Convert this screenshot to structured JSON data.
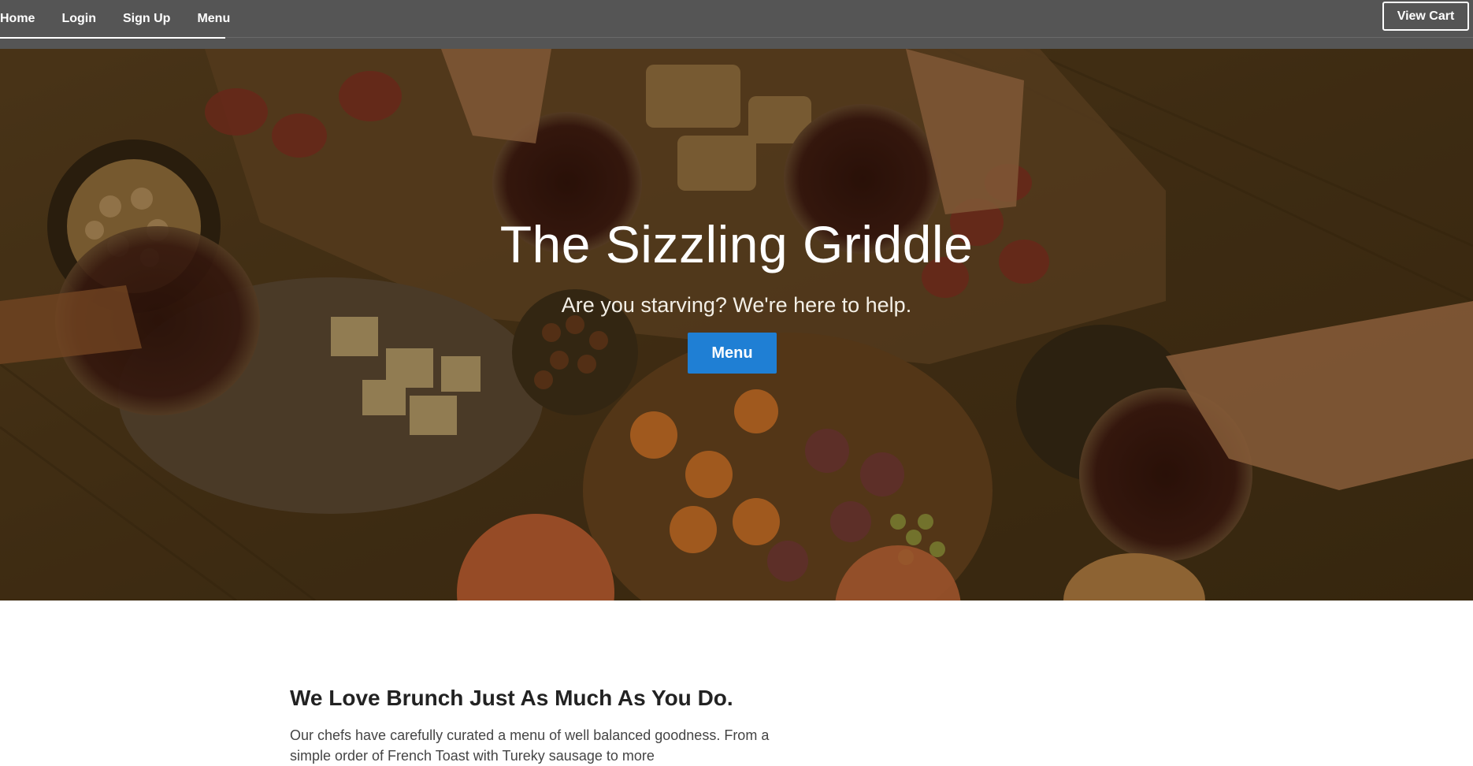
{
  "nav": {
    "items": [
      {
        "label": "Home"
      },
      {
        "label": "Login"
      },
      {
        "label": "Sign Up"
      },
      {
        "label": "Menu"
      }
    ],
    "cart_label": "View Cart"
  },
  "hero": {
    "title": "The Sizzling Griddle",
    "subtitle": "Are you starving? We're here to help.",
    "button_label": "Menu"
  },
  "intro": {
    "title": "We Love Brunch Just As Much As You Do.",
    "text": "Our chefs have carefully curated a menu of well balanced goodness. From a simple order of French Toast with Tureky sausage to more"
  },
  "colors": {
    "nav_bg": "#555555",
    "accent": "#1f7fd4"
  }
}
